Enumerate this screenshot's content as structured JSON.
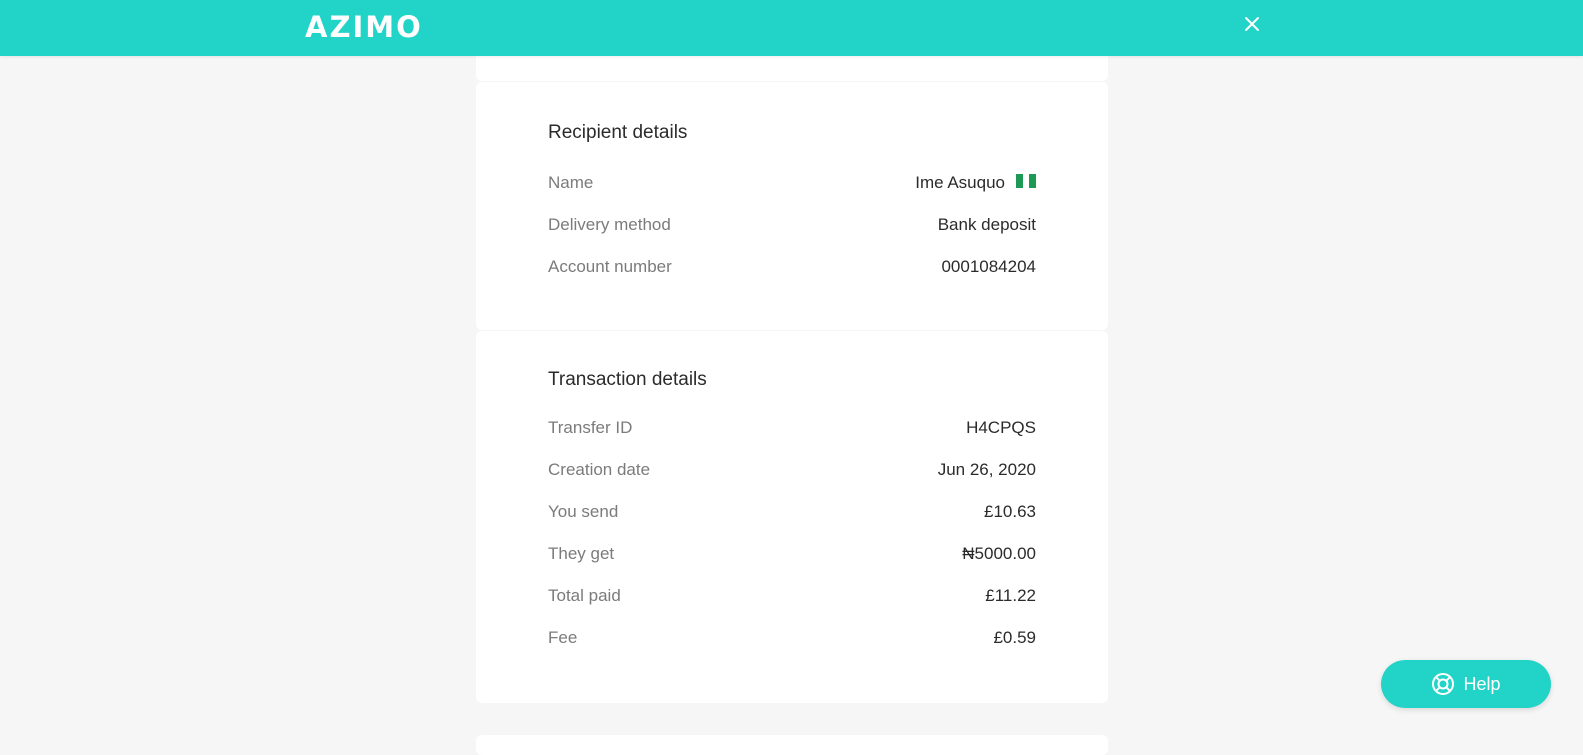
{
  "header": {
    "logo": "AZIMO",
    "brand_color": "#21d4c7",
    "close_icon": "close-icon"
  },
  "recipient": {
    "title": "Recipient details",
    "rows": [
      {
        "label": "Name",
        "value": "Ime Asuquo"
      },
      {
        "label": "Delivery method",
        "value": "Bank deposit"
      },
      {
        "label": "Account number",
        "value": "0001084204"
      }
    ],
    "flag_icon": "nigeria-flag-icon"
  },
  "transaction": {
    "title": "Transaction details",
    "rows": [
      {
        "label": "Transfer ID",
        "value": "H4CPQS"
      },
      {
        "label": "Creation date",
        "value": "Jun 26, 2020"
      },
      {
        "label": "You send",
        "value": "£10.63"
      },
      {
        "label": "They get",
        "value": "₦5000.00"
      },
      {
        "label": "Total paid",
        "value": "£11.22"
      },
      {
        "label": "Fee",
        "value": "£0.59"
      }
    ]
  },
  "help": {
    "label": "Help",
    "icon": "lifebuoy-icon"
  }
}
